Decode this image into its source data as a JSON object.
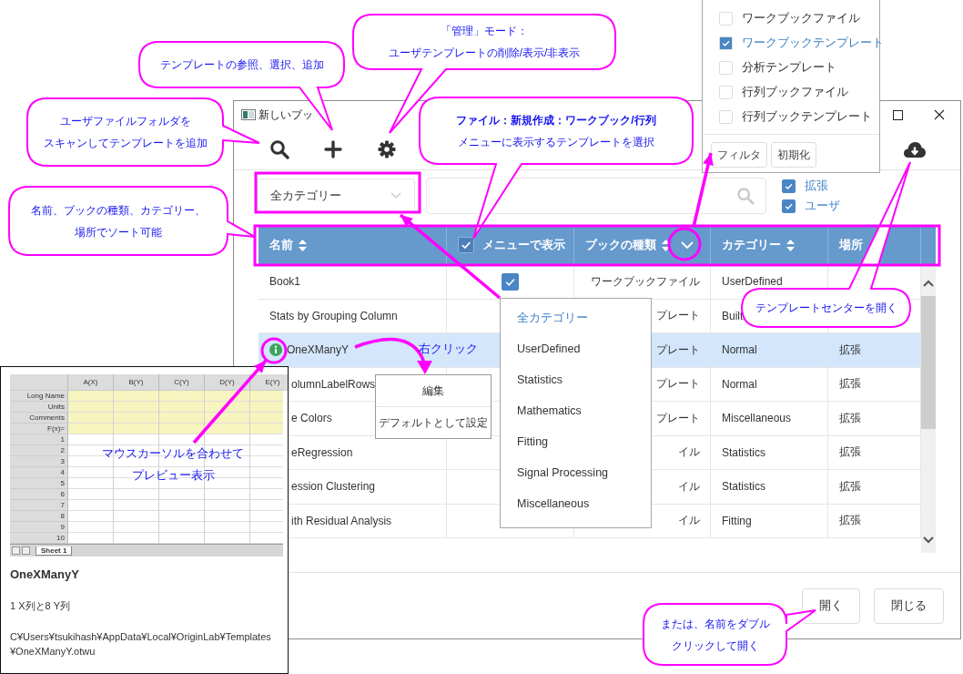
{
  "window": {
    "title": "新しいブッ"
  },
  "filter_bar": {
    "category": "全カテゴリー",
    "sources": [
      {
        "label": "拡張",
        "checked": true
      },
      {
        "label": "ユーザ",
        "checked": true
      }
    ]
  },
  "table": {
    "columns": [
      {
        "label": "名前",
        "sortable": true,
        "filter": false
      },
      {
        "label": "メニューで表示",
        "sortable": false,
        "filter": false,
        "checked": true
      },
      {
        "label": "ブックの種類",
        "sortable": true,
        "filter": true
      },
      {
        "label": "カテゴリー",
        "sortable": true,
        "filter": false
      },
      {
        "label": "場所",
        "sortable": false,
        "filter": false
      }
    ],
    "rows": [
      {
        "name": "Book1",
        "selected": false,
        "hovered": false,
        "menu_checked": true,
        "type": "ワークブックファイル",
        "category": "UserDefined"
      },
      {
        "name": "Stats by Grouping Column",
        "selected": false,
        "hovered": false,
        "type": "プレート",
        "category": "Built"
      },
      {
        "name": "OneXManyY",
        "selected": true,
        "hovered": true,
        "type": "プレート",
        "category": "Normal",
        "location": "拡張"
      },
      {
        "name": "olumnLabelRows",
        "selected": false,
        "hovered": false,
        "type": "プレート",
        "category": "Normal",
        "location": "拡張"
      },
      {
        "name": "e Colors",
        "selected": false,
        "hovered": false,
        "type": "プレート",
        "category": "Miscellaneous",
        "location": "拡張"
      },
      {
        "name": "eRegression",
        "selected": false,
        "hovered": false,
        "type": "イル",
        "category": "Statistics",
        "location": "拡張"
      },
      {
        "name": "ession Clustering",
        "selected": false,
        "hovered": false,
        "type": "イル",
        "category": "Statistics",
        "location": "拡張"
      },
      {
        "name": "ith Residual Analysis",
        "selected": false,
        "hovered": false,
        "type": "イル",
        "category": "Fitting",
        "location": "拡張"
      }
    ]
  },
  "buttons": [
    "開く",
    "閉じる"
  ],
  "type_filter_menu": {
    "items": [
      {
        "label": "ワークブックファイル",
        "checked": false
      },
      {
        "label": "ワークブックテンプレート",
        "checked": true
      },
      {
        "label": "分析テンプレート",
        "checked": false
      },
      {
        "label": "行列ブックファイル",
        "checked": false
      },
      {
        "label": "行列ブックテンプレート",
        "checked": false
      }
    ],
    "buttons": [
      "フィルタ",
      "初期化"
    ]
  },
  "category_menu": {
    "items": [
      {
        "label": "全カテゴリー",
        "selected": true
      },
      {
        "label": "UserDefined",
        "selected": false
      },
      {
        "label": "Statistics",
        "selected": false
      },
      {
        "label": "Mathematics",
        "selected": false
      },
      {
        "label": "Fitting",
        "selected": false
      },
      {
        "label": "Signal Processing",
        "selected": false
      },
      {
        "label": "Miscellaneous",
        "selected": false
      }
    ]
  },
  "context_menu": {
    "items": [
      "編集",
      "デフォルトとして設定"
    ]
  },
  "preview": {
    "sheet": {
      "columns": [
        "A(X)",
        "B(Y)",
        "C(Y)",
        "D(Y)",
        "E(Y)"
      ],
      "label_rows": [
        "Long Name",
        "Units",
        "Comments",
        "F(x)="
      ],
      "rows": [
        "1",
        "2",
        "3",
        "4",
        "5",
        "6",
        "7",
        "8",
        "9",
        "10"
      ],
      "tab": "Sheet 1"
    },
    "name": "OneXManyY",
    "description": "1 X列と8 Y列",
    "path": "C¥Users¥tsukihash¥AppData¥Local¥OriginLab¥Templates¥OneXManyY.otwu"
  },
  "callouts": [
    {
      "lines": [
        "ユーザファイルフォルダを",
        "スキャンしてテンプレートを追加"
      ],
      "bold_first_line": false
    },
    {
      "lines": [
        "テンプレートの参照、選択、追加"
      ],
      "bold_first_line": false
    },
    {
      "lines": [
        "「管理」モード：",
        "ユーザテンプレートの削除/表示/非表示"
      ],
      "bold_first_line": false
    },
    {
      "lines": [
        "ファイル：新規作成：ワークブック/行列",
        "メニューに表示するテンプレートを選択"
      ],
      "bold_first_line": true
    },
    {
      "lines": [
        "名前、ブックの種類、カテゴリー、",
        "場所でソート可能"
      ],
      "bold_first_line": false
    },
    {
      "lines": [
        "テンプレートセンターを開く"
      ],
      "bold_first_line": false
    },
    {
      "lines": [
        "または、名前をダブル",
        "クリックして開く"
      ],
      "bold_first_line": false
    }
  ],
  "notes": [
    {
      "lines": [
        "右クリック"
      ]
    },
    {
      "lines": [
        "マウスカーソルを合わせて",
        "プレビュー表示"
      ]
    }
  ]
}
